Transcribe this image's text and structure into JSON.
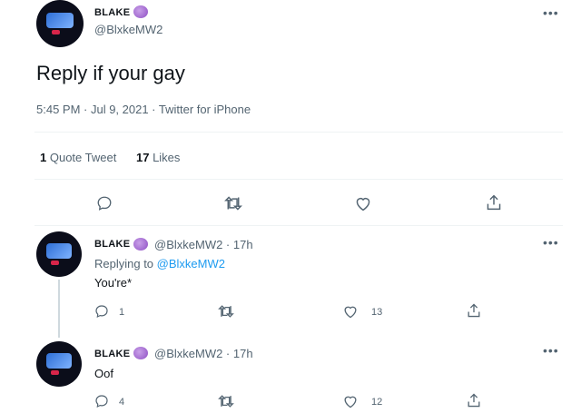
{
  "tweet": {
    "display_name": "BLAKE",
    "handle": "@BlxkeMW2",
    "text": "Reply if your gay",
    "meta": "5:45 PM · Jul 9, 2021 · Twitter for iPhone",
    "quote_count": "1",
    "quote_label": "Quote Tweet",
    "like_count": "17",
    "like_label": "Likes"
  },
  "replies": [
    {
      "display_name": "BLAKE",
      "handle_time": "@BlxkeMW2 · 17h",
      "replying_prefix": "Replying to",
      "replying_to": "@BlxkeMW2",
      "text": "You're*",
      "reply_count": "1",
      "like_count": "13"
    },
    {
      "display_name": "BLAKE",
      "handle_time": "@BlxkeMW2 · 17h",
      "text": "Oof",
      "reply_count": "4",
      "like_count": "12"
    }
  ],
  "icons": [
    "reply-icon",
    "retweet-icon",
    "like-icon",
    "share-icon",
    "more-icon",
    "emoji-badge-icon"
  ],
  "colors": {
    "accent": "#1d9bf0",
    "text": "#0f1419",
    "muted": "#536471",
    "divider": "#eff3f4"
  }
}
